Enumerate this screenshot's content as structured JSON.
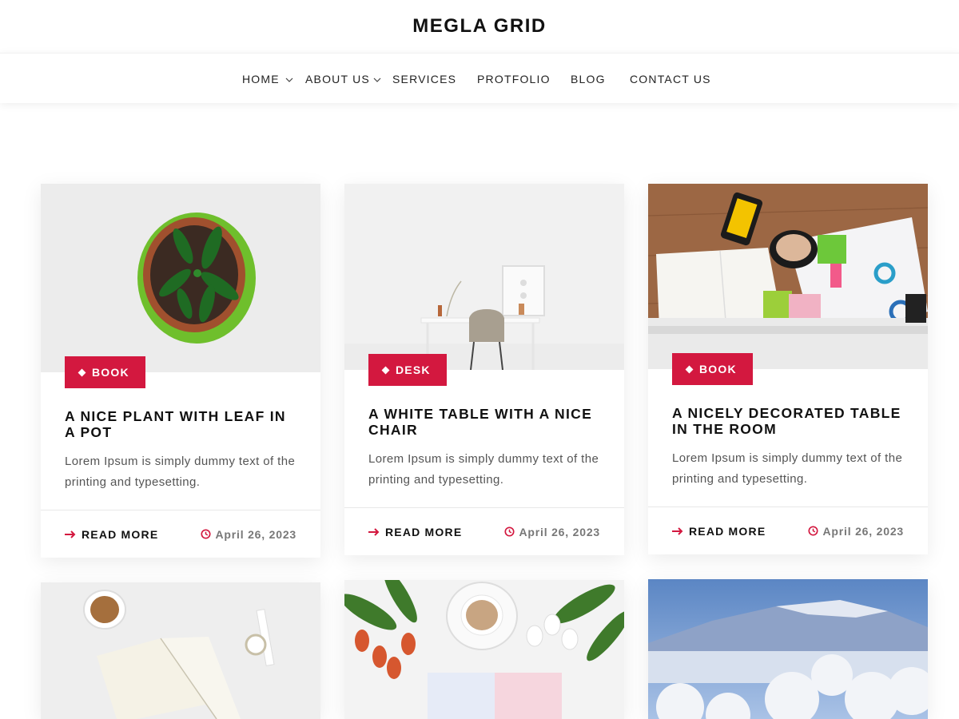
{
  "site": {
    "title": "MEGLA GRID"
  },
  "nav": {
    "home": "HOME",
    "about": "ABOUT US",
    "services": "SERVICES",
    "portfolio": "PROTFOLIO",
    "blog": "BLOG",
    "contact": "CONTACT US"
  },
  "colors": {
    "accent": "#d3183f",
    "text": "#111111",
    "muted": "#777777"
  },
  "posts": [
    {
      "tag": "BOOK",
      "title": "A NICE PLANT WITH LEAF IN A POT",
      "excerpt": "Lorem Ipsum is simply dummy text of the printing and typesetting.",
      "read_more": "READ MORE",
      "date": "April 26, 2023"
    },
    {
      "tag": "DESK",
      "title": "A WHITE TABLE WITH A NICE CHAIR",
      "excerpt": "Lorem Ipsum is simply dummy text of the printing and typesetting.",
      "read_more": "READ MORE",
      "date": "April 26, 2023"
    },
    {
      "tag": "BOOK",
      "title": "A NICELY DECORATED TABLE IN THE ROOM",
      "excerpt": "Lorem Ipsum is simply dummy text of the printing and typesetting.",
      "read_more": "READ MORE",
      "date": "April 26, 2023"
    }
  ],
  "icons": {
    "read_more": "arrow-right-icon",
    "date": "clock-icon",
    "tag": "diamond-icon",
    "nav_submenu": "chevron-down-icon"
  }
}
